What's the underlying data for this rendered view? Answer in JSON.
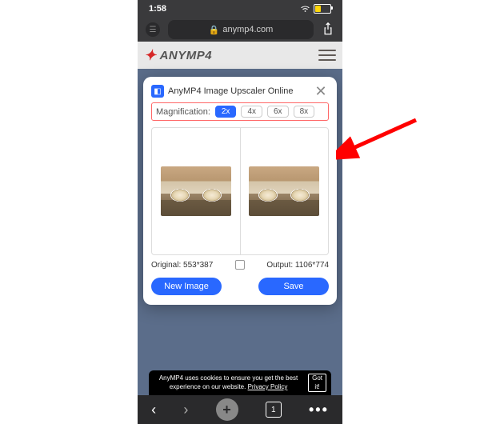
{
  "status": {
    "time": "1:58",
    "tabs": "1"
  },
  "urlbar": {
    "domain": "anymp4.com"
  },
  "header": {
    "brand": "ANYMP4"
  },
  "modal": {
    "title": "AnyMP4 Image Upscaler Online",
    "magnification_label": "Magnification:",
    "options": {
      "x2": "2x",
      "x4": "4x",
      "x6": "6x",
      "x8": "8x"
    },
    "selected": "2x",
    "original_label": "Original: 553*387",
    "output_label": "Output: 1106*774",
    "new_image": "New Image",
    "save": "Save"
  },
  "cookie": {
    "text": "AnyMP4 uses cookies to ensure you get the best experience on our website.",
    "policy": "Privacy Policy",
    "accept": "Got it!"
  }
}
